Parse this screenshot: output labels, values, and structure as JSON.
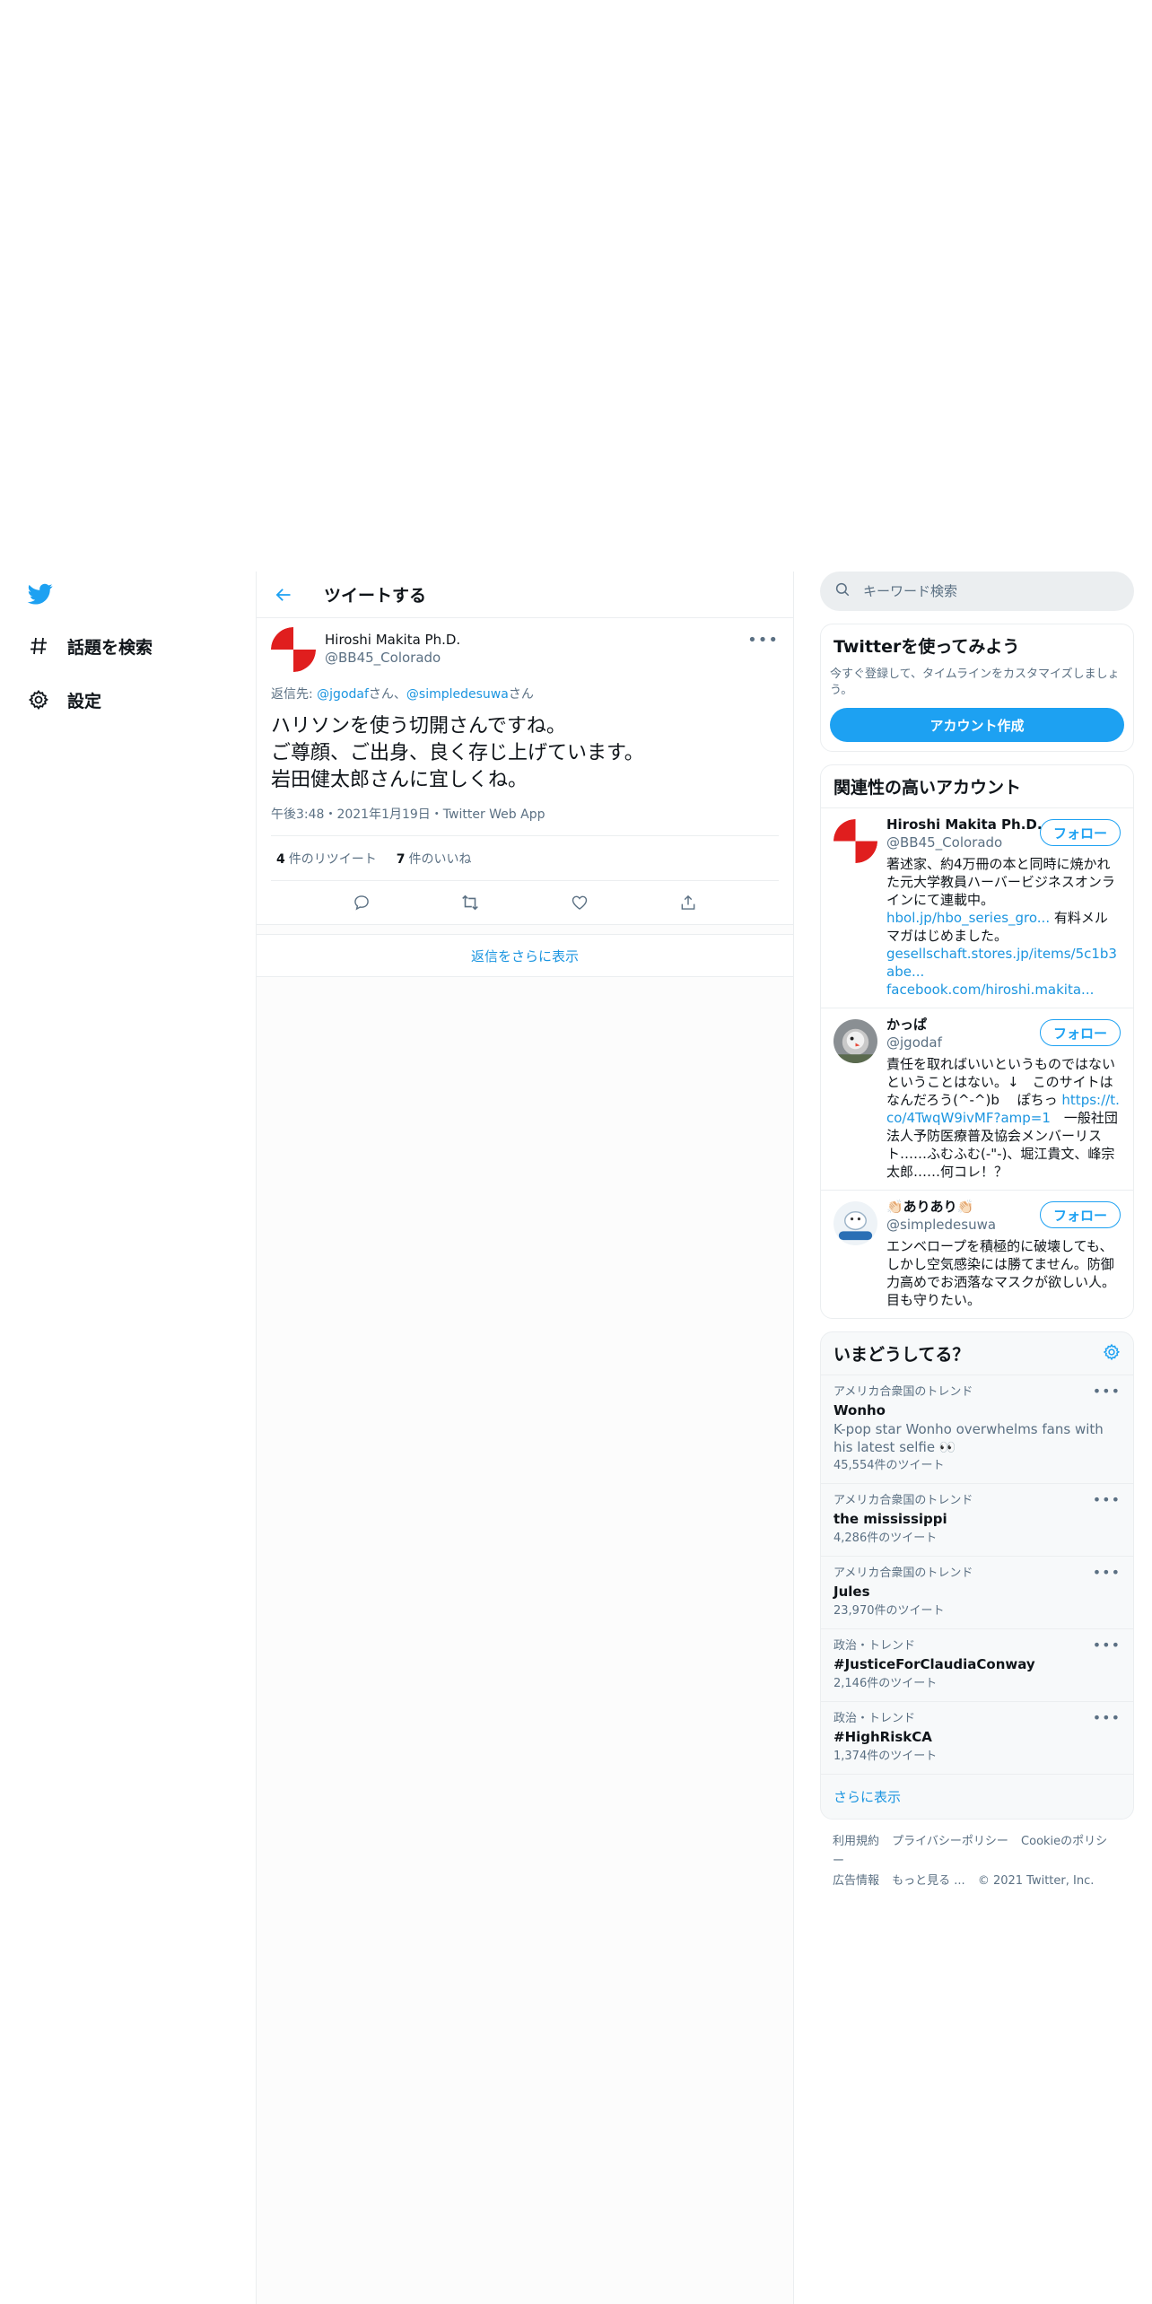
{
  "colors": {
    "accent": "#1da1f2",
    "link": "#1b95e0",
    "secondary_text": "#5b7083",
    "border": "#ebeef0",
    "avatar_red": "#e01e1e"
  },
  "nav": {
    "logo_icon": "twitter-bird-icon",
    "explore_label": "話題を検索",
    "settings_label": "設定"
  },
  "header": {
    "title": "ツイートする"
  },
  "tweet": {
    "author_name": "Hiroshi Makita Ph.D.",
    "author_handle": "@BB45_Colorado",
    "reply_prefix": "返信先: ",
    "reply_user1": "@jgodaf",
    "reply_sep1": "さん、",
    "reply_user2": "@simpledesuwa",
    "reply_sep2": "さん",
    "text": "ハリソンを使う切開さんですね。\nご尊顔、ご出身、良く存じ上げています。\n岩田健太郎さんに宜しくね。",
    "meta": "午後3:48・2021年1月19日・Twitter Web App",
    "retweet_count": "4",
    "retweet_label": "件のリツイート",
    "like_count": "7",
    "like_label": "件のいいね"
  },
  "show_more_replies": "返信をさらに表示",
  "search": {
    "placeholder": "キーワード検索"
  },
  "signup": {
    "title": "Twitterを使ってみよう",
    "desc": "今すぐ登録して、タイムラインをカスタマイズしましょう。",
    "button": "アカウント作成"
  },
  "related": {
    "title": "関連性の高いアカウント",
    "follow_label": "フォロー",
    "accounts": [
      {
        "name": "Hiroshi Makita Ph.D.",
        "handle": "@BB45_Colorado",
        "bio_text": "著述家、約4万冊の本と同時に焼かれた元大学教員ハーバービジネスオンラインにて連載中。",
        "bio_link1": "hbol.jp/hbo_series_gro...",
        "bio_mid": " 有料メルマガはじめました。",
        "bio_link2": "gesellschaft.stores.jp/items/5c1b3abe...",
        "bio_link3": "facebook.com/hiroshi.makita..."
      },
      {
        "name": "かっぱ",
        "handle": "@jgodaf",
        "bio_text": "責任を取ればいいというものではないということはない。↓　このサイトはなんだろう(^-^)b　 ぽちっ ",
        "bio_link1": "https://t.co/4TwqW9ivMF?amp=1",
        "bio_tail": "　一般社団法人予防医療普及協会メンバーリスト……ふむふむ(-\"-)、堀江貴文、峰宗太郎……何コレ！？"
      },
      {
        "name": "👏🏻ありあり👏🏻",
        "handle": "@simpledesuwa",
        "bio_text": "エンベロープを積極的に破壊しても、しかし空気感染には勝てません。防御力高めでお洒落なマスクが欲しい人。目も守りたい。"
      }
    ]
  },
  "trends": {
    "title": "いまどうしてる？",
    "settings_icon": "gear-icon",
    "items": [
      {
        "context": "アメリカ合衆国のトレンド",
        "name": "Wonho",
        "desc": "K-pop star Wonho overwhelms fans with his latest selfie 👀",
        "count": "45,554件のツイート"
      },
      {
        "context": "アメリカ合衆国のトレンド",
        "name": "the mississippi",
        "desc": "",
        "count": "4,286件のツイート"
      },
      {
        "context": "アメリカ合衆国のトレンド",
        "name": "Jules",
        "desc": "",
        "count": "23,970件のツイート"
      },
      {
        "context": "政治・トレンド",
        "name": "#JusticeForClaudiaConway",
        "desc": "",
        "count": "2,146件のツイート"
      },
      {
        "context": "政治・トレンド",
        "name": "#HighRiskCA",
        "desc": "",
        "count": "1,374件のツイート"
      }
    ],
    "show_more": "さらに表示"
  },
  "footer": {
    "terms": "利用規約",
    "privacy": "プライバシーポリシー",
    "cookie": "Cookieのポリシー",
    "ads": "広告情報",
    "more": "もっと見る ...",
    "copyright": "© 2021 Twitter, Inc."
  }
}
